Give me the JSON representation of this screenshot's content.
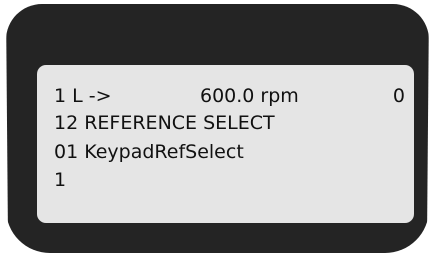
{
  "display": {
    "status_line": {
      "mode": "1 L ->",
      "value": "600.0 rpm",
      "state": "0"
    },
    "parameter_group": "12 REFERENCE SELECT",
    "parameter_name": "01 KeypadRefSelect",
    "parameter_value": "1"
  },
  "colors": {
    "bezel": "#242424",
    "screen": "#e5e5e5",
    "text": "#111111"
  }
}
